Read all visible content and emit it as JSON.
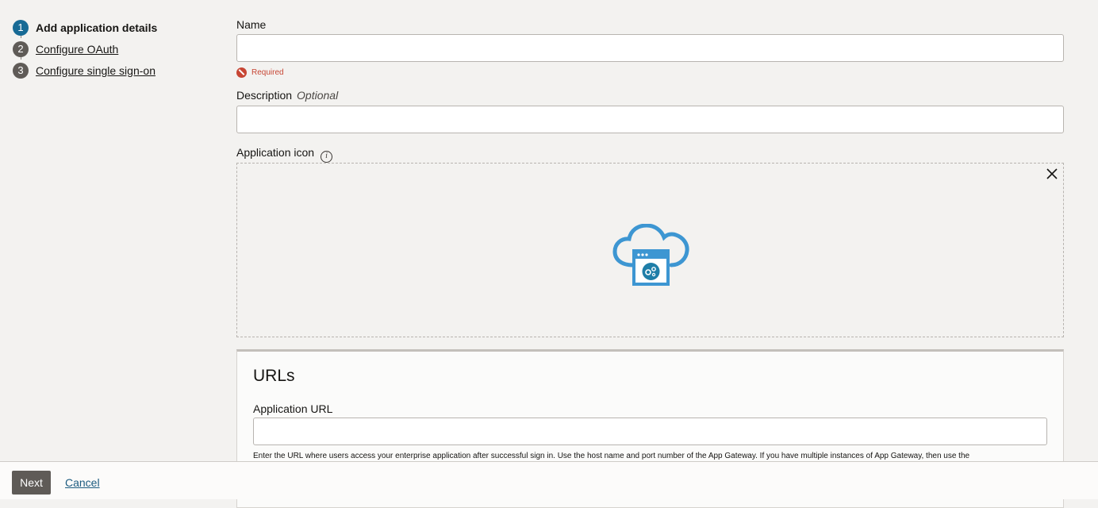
{
  "stepper": {
    "steps": [
      {
        "number": "1",
        "label": "Add application details"
      },
      {
        "number": "2",
        "label": "Configure OAuth"
      },
      {
        "number": "3",
        "label": "Configure single sign-on"
      }
    ],
    "active_step": 1
  },
  "form": {
    "name": {
      "label": "Name",
      "value": "",
      "error": "Required"
    },
    "description": {
      "label": "Description",
      "optional": "Optional",
      "value": ""
    },
    "application_icon": {
      "label": "Application icon",
      "info_icon": "info-icon",
      "remove_icon": "close-icon",
      "image_icon": "cloud-app-gear-icon"
    }
  },
  "urls_panel": {
    "title": "URLs",
    "application_url": {
      "label": "Application URL",
      "value": "",
      "help": "Enter the URL where users access your enterprise application after successful sign in. Use the host name and port number of the App Gateway. If you have multiple instances of App Gateway, then use the"
    }
  },
  "footer": {
    "next_label": "Next",
    "cancel_label": "Cancel"
  },
  "colors": {
    "active_step": "#176a95",
    "inactive_step": "#5f5b57",
    "error": "#c74634",
    "icon_blue": "#3d96d2",
    "icon_teal": "#1f7ea8"
  }
}
